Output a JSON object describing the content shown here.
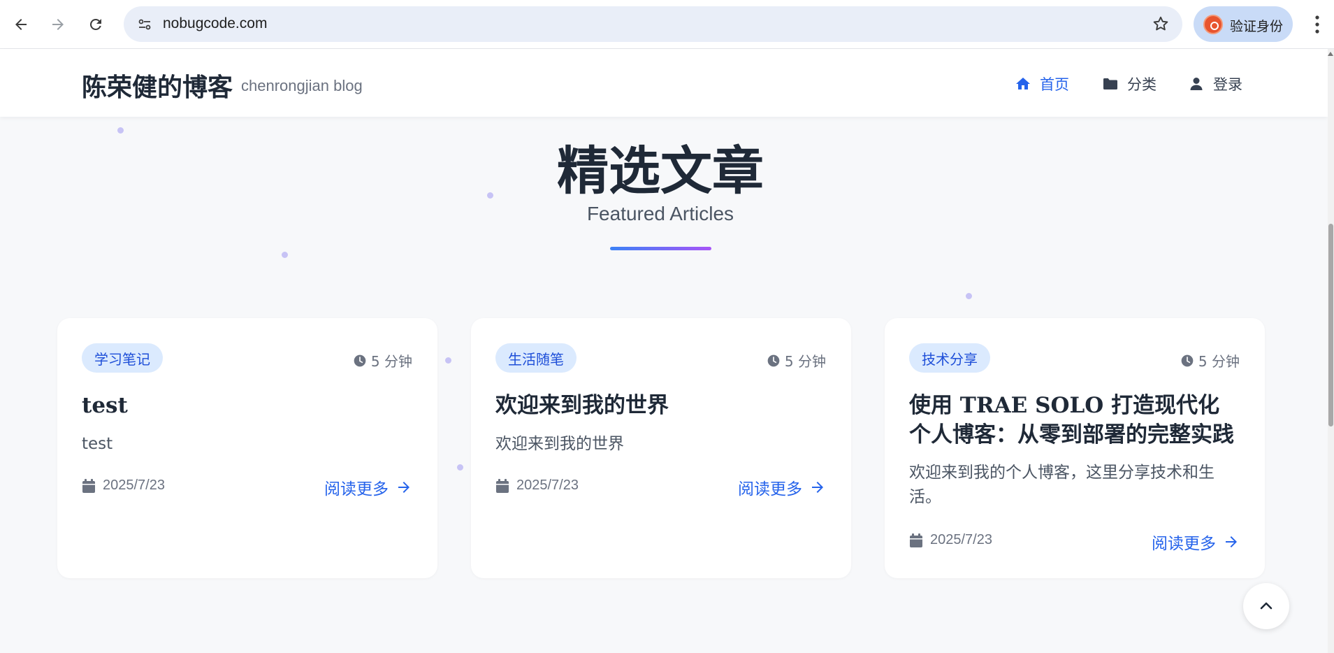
{
  "browser": {
    "url": "nobugcode.com",
    "profile_label": "验证身份",
    "icons": [
      "back-arrow-icon",
      "forward-arrow-icon",
      "reload-icon",
      "site-settings-icon",
      "bookmark-star-icon",
      "profile-avatar-icon",
      "menu-dots-icon"
    ]
  },
  "site": {
    "brand": "陈荣健的博客",
    "brand_sub": "chenrongjian blog",
    "nav": [
      {
        "label": "首页",
        "icon": "home-icon",
        "active": true
      },
      {
        "label": "分类",
        "icon": "folder-icon",
        "active": false
      },
      {
        "label": "登录",
        "icon": "user-icon",
        "active": false
      }
    ]
  },
  "hero": {
    "title": "精选文章",
    "subtitle": "Featured Articles"
  },
  "articles": [
    {
      "tag": "学习笔记",
      "read_time": "5 分钟",
      "title": "test",
      "excerpt": "test",
      "date": "2025/7/23",
      "read_more": "阅读更多"
    },
    {
      "tag": "生活随笔",
      "read_time": "5 分钟",
      "title": "欢迎来到我的世界",
      "excerpt": "欢迎来到我的世界",
      "date": "2025/7/23",
      "read_more": "阅读更多"
    },
    {
      "tag": "技术分享",
      "read_time": "5 分钟",
      "title": "使用 TRAE SOLO 打造现代化个人博客：从零到部署的完整实践",
      "excerpt": "欢迎来到我的个人博客，这里分享技术和生活。",
      "date": "2025/7/23",
      "read_more": "阅读更多"
    }
  ],
  "colors": {
    "accent": "#2563eb",
    "tag_bg": "#dbeafe",
    "gradient_start": "#3b82f6",
    "gradient_end": "#a855f7"
  }
}
